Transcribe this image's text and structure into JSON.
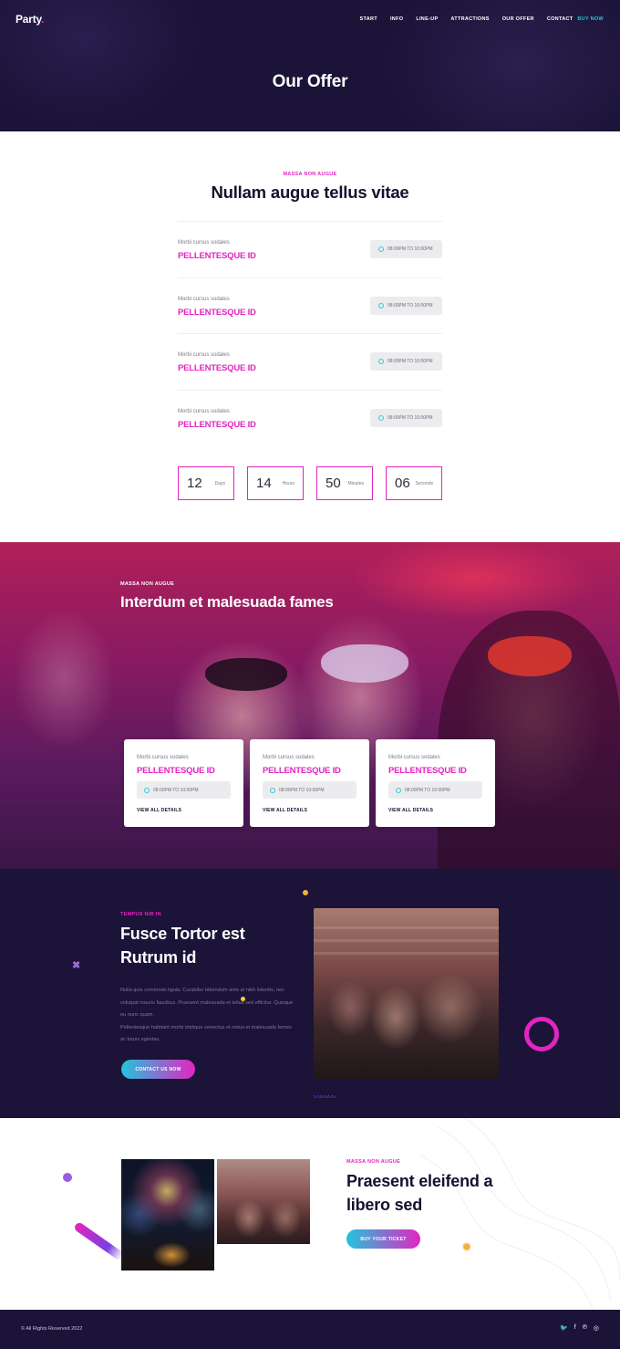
{
  "header": {
    "logo": "Party",
    "logo_dot": ".",
    "nav": [
      "START",
      "INFO",
      "LINE-UP",
      "ATTRACTIONS",
      "OUR OFFER",
      "CONTACT"
    ],
    "buy_now": "BUY NOW",
    "title": "Our Offer"
  },
  "schedule": {
    "eyebrow": "MASSA NON AUGUE",
    "title": "Nullam augue tellus vitae",
    "rows": [
      {
        "sub": "Morbi cursus sodales",
        "name": "PELLENTESQUE ID",
        "time": "08:00PM TO 10:00PM"
      },
      {
        "sub": "Morbi cursus sodales",
        "name": "PELLENTESQUE ID",
        "time": "08:00PM TO 10:00PM"
      },
      {
        "sub": "Morbi cursus sodales",
        "name": "PELLENTESQUE ID",
        "time": "08:00PM TO 10:00PM"
      },
      {
        "sub": "Morbi cursus sodales",
        "name": "PELLENTESQUE ID",
        "time": "08:00PM TO 10:00PM"
      }
    ],
    "countdown": [
      {
        "value": "12",
        "label": "Days"
      },
      {
        "value": "14",
        "label": "Hours"
      },
      {
        "value": "50",
        "label": "Minutes"
      },
      {
        "value": "06",
        "label": "Seconds"
      }
    ]
  },
  "party": {
    "eyebrow": "MASSA NON AUGUE",
    "title": "Interdum et malesuada fames",
    "cards": [
      {
        "sub": "Morbi cursus sodales",
        "name": "PELLENTESQUE ID",
        "time": "08:00PM TO 10:00PM",
        "link": "VIEW ALL DETAILS"
      },
      {
        "sub": "Morbi cursus sodales",
        "name": "PELLENTESQUE ID",
        "time": "08:00PM TO 10:00PM",
        "link": "VIEW ALL DETAILS"
      },
      {
        "sub": "Morbi cursus sodales",
        "name": "PELLENTESQUE ID",
        "time": "08:00PM TO 10:00PM",
        "link": "VIEW ALL DETAILS"
      }
    ]
  },
  "about": {
    "eyebrow": "TEMPUS NIB IN",
    "title": "Fusce Tortor est Rutrum id",
    "text_1": "Nulla quis commodo ligula. Curabitur bibendum ante at nibh lobortis, nec volutpat mauris faucibus. Praesent malesuada et tellus sed efficitur. Quisque eu nunc quam.",
    "text_2": "Pellentesque habitant morbi tristique senectus et netus et malesuada fames ac turpis egestas.",
    "button": "CONTACT US NOW"
  },
  "ticket": {
    "eyebrow": "MASSA NON AUGUE",
    "title": "Praesent eleifend a libero sed",
    "button": "BUY YOUR TICKET"
  },
  "footer": {
    "copyright": "© All Rights Reserved 2022",
    "social_icons": [
      "twitter-icon",
      "facebook-icon",
      "pinterest-icon",
      "instagram-icon"
    ]
  },
  "colors": {
    "navy": "#1b1338",
    "magenta": "#e225c1",
    "cyan": "#22c4dc"
  }
}
